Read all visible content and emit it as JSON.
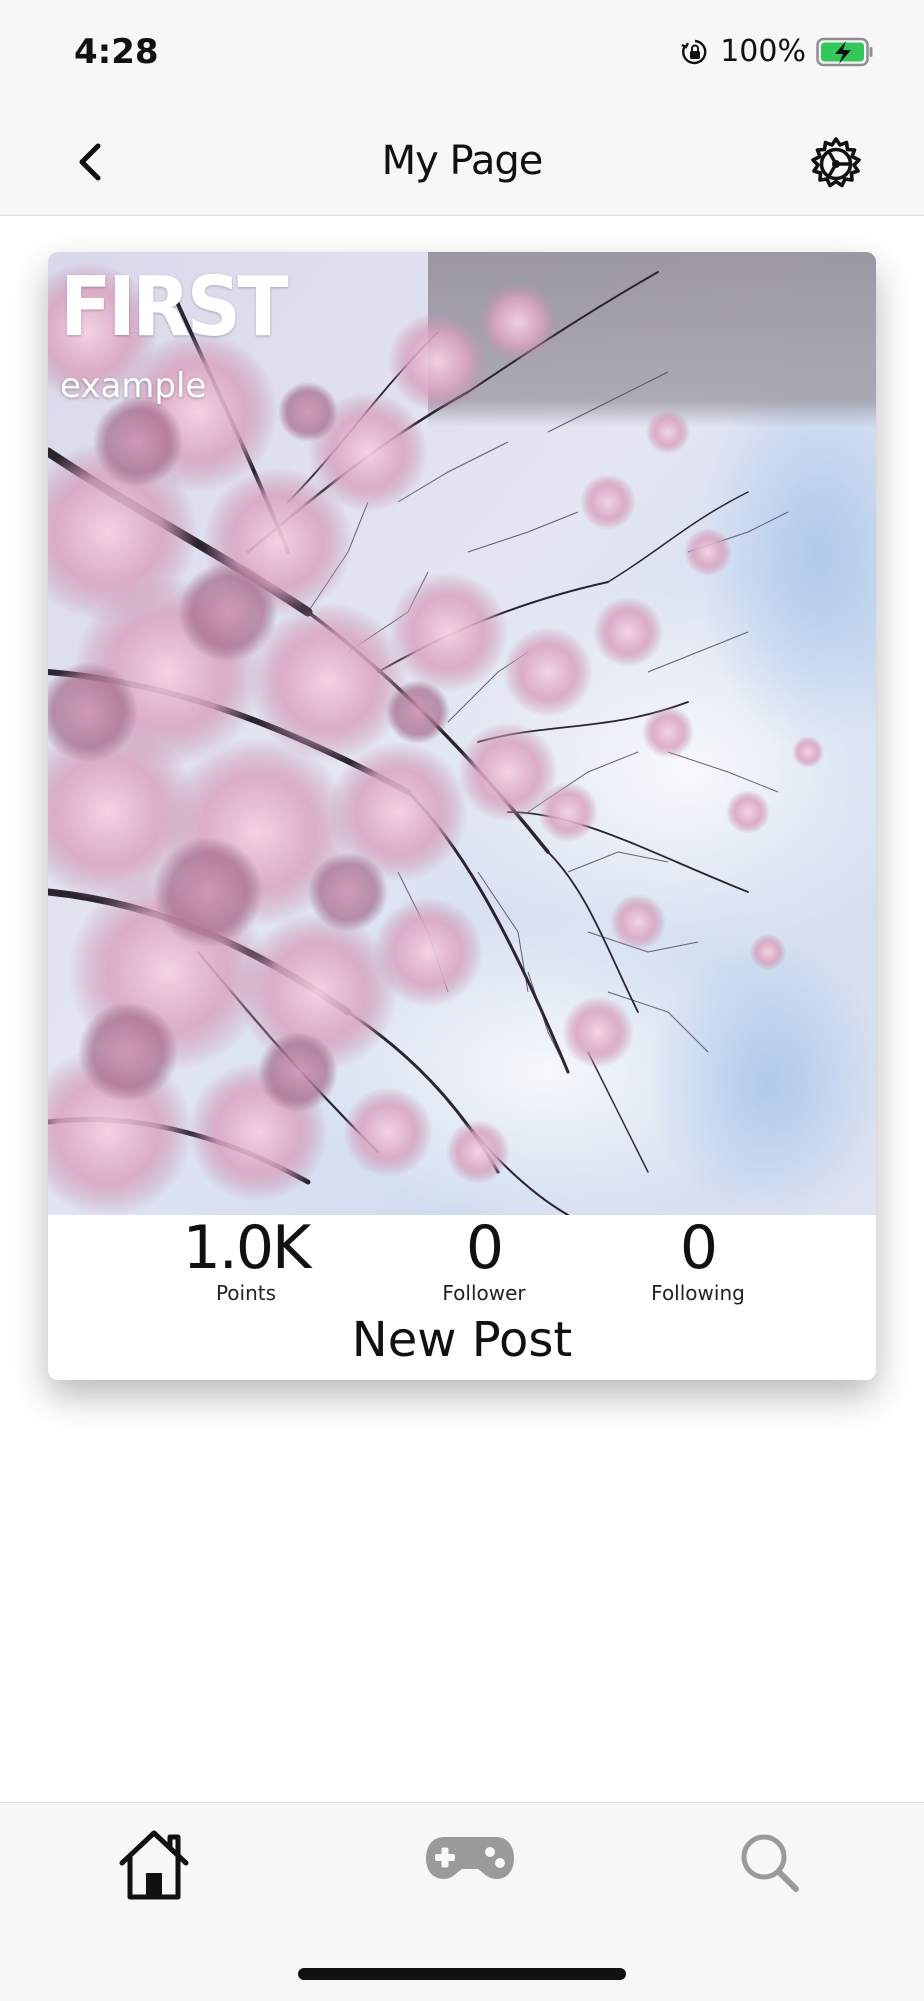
{
  "status_bar": {
    "time": "4:28",
    "battery_percent": "100%",
    "icons": [
      "orientation-lock-icon",
      "battery-charging-icon"
    ],
    "battery_color": "#34c759"
  },
  "nav": {
    "title": "My Page",
    "back_icon": "chevron-left-icon",
    "settings_icon": "gear-icon"
  },
  "profile": {
    "name": "FIRST",
    "subtitle": "example",
    "cover_image": "cherry-blossom-branches"
  },
  "stats": [
    {
      "value": "1.0K",
      "label": "Points"
    },
    {
      "value": "0",
      "label": "Follower"
    },
    {
      "value": "0",
      "label": "Following"
    }
  ],
  "actions": {
    "new_post": "New Post"
  },
  "tab_bar": {
    "tabs": [
      {
        "icon": "home-icon",
        "selected": true
      },
      {
        "icon": "gamepad-icon",
        "selected": false
      },
      {
        "icon": "search-icon",
        "selected": false
      }
    ]
  }
}
